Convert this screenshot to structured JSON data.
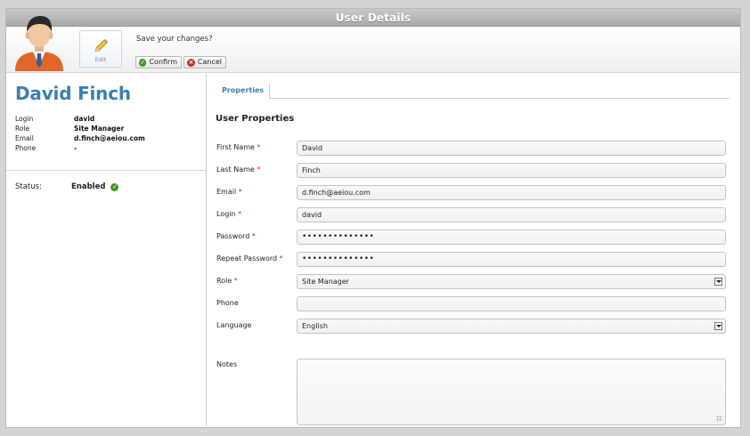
{
  "window": {
    "title": "User Details"
  },
  "toolbar": {
    "edit_label": "Edit",
    "prompt": "Save your changes?",
    "confirm_label": "Confirm",
    "cancel_label": "Cancel"
  },
  "user": {
    "name": "David Finch",
    "info": [
      {
        "key": "Login",
        "value": "david"
      },
      {
        "key": "Role",
        "value": "Site Manager"
      },
      {
        "key": "Email",
        "value": "d.finch@aeiou.com"
      },
      {
        "key": "Phone",
        "value": "-"
      }
    ],
    "status_label": "Status:",
    "status_value": "Enabled"
  },
  "tabs": [
    "Properties"
  ],
  "form": {
    "section_title": "User Properties",
    "fields": {
      "first_name": {
        "label": "First Name",
        "value": "David",
        "required": true
      },
      "last_name": {
        "label": "Last Name",
        "value": "Finch",
        "required": true
      },
      "email": {
        "label": "Email",
        "value": "d.finch@aeiou.com",
        "required": true
      },
      "login": {
        "label": "Login",
        "value": "david",
        "required": true
      },
      "password": {
        "label": "Password",
        "value": "••••••••••••••",
        "required": true
      },
      "repeat_password": {
        "label": "Repeat Password",
        "value": "••••••••••••••",
        "required": true
      },
      "role": {
        "label": "Role",
        "value": "Site Manager",
        "required": true
      },
      "phone": {
        "label": "Phone",
        "value": "",
        "required": false
      },
      "language": {
        "label": "Language",
        "value": "English",
        "required": false
      },
      "notes": {
        "label": "Notes",
        "value": "",
        "required": false
      }
    }
  },
  "colors": {
    "accent": "#3a7fb0",
    "required": "#c62d1f",
    "enabled": "#3d9b2a"
  },
  "icons": [
    "user-avatar-icon",
    "pencil-icon",
    "confirm-check-icon",
    "cancel-x-icon",
    "status-enabled-icon",
    "dropdown-arrow-icon",
    "resize-grip-icon"
  ]
}
